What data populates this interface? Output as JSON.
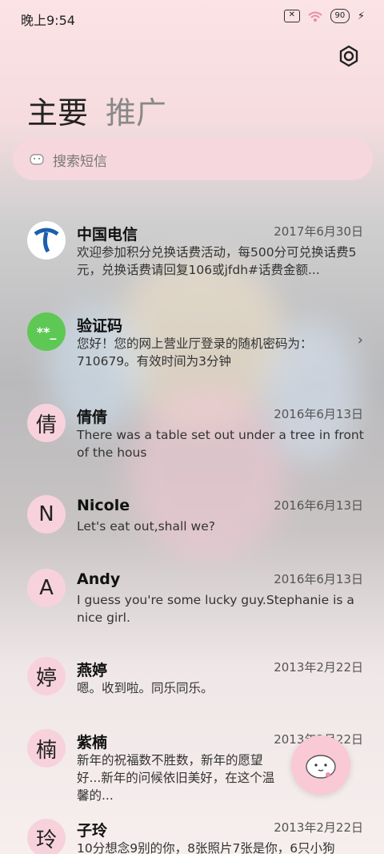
{
  "status": {
    "time": "晚上9:54",
    "battery": "90"
  },
  "tabs": {
    "main": "主要",
    "promo": "推广"
  },
  "search": {
    "placeholder": "搜索短信"
  },
  "threads": [
    {
      "sender": "中国电信",
      "date": "2017年6月30日",
      "preview": "欢迎参加积分兑换话费活动，每500分可兑换话费5元，兑换话费请回复106或jfdh#话费金额..."
    },
    {
      "sender": "验证码",
      "avatar": "**_",
      "preview": "您好！您的网上营业厅登录的随机密码为：710679。有效时间为3分钟"
    },
    {
      "sender": "倩倩",
      "avatar": "倩",
      "date": "2016年6月13日",
      "preview": "There was a table set out under a tree in front of the hous"
    },
    {
      "sender": "Nicole",
      "avatar": "N",
      "date": "2016年6月13日",
      "preview": "Let's eat out,shall we?"
    },
    {
      "sender": "Andy",
      "avatar": "A",
      "date": "2016年6月13日",
      "preview": "I guess you're some lucky guy.Stephanie is a nice girl."
    },
    {
      "sender": "燕婷",
      "avatar": "婷",
      "date": "2013年2月22日",
      "preview": "嗯。收到啦。同乐同乐。"
    },
    {
      "sender": "紫楠",
      "avatar": "楠",
      "date": "2013年2月22日",
      "preview": "新年的祝福数不胜数，新年的愿望好...新年的问候依旧美好，在这个温馨的..."
    },
    {
      "sender": "子玲",
      "avatar": "玲",
      "date": "2013年2月22日",
      "preview": "10分想念9别的你，8张照片7张是你，6只小狗"
    }
  ]
}
